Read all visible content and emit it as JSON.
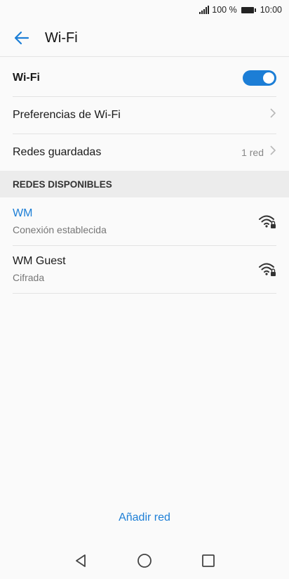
{
  "status_bar": {
    "battery_pct": "100 %",
    "time": "10:00"
  },
  "app_bar": {
    "title": "Wi-Fi"
  },
  "settings": {
    "wifi_label": "Wi-Fi",
    "wifi_enabled": true,
    "preferences_label": "Preferencias de Wi-Fi",
    "saved_label": "Redes guardadas",
    "saved_count": "1 red"
  },
  "available": {
    "header": "REDES DISPONIBLES",
    "networks": [
      {
        "name": "WM",
        "status": "Conexión establecida",
        "connected": true
      },
      {
        "name": "WM Guest",
        "status": "Cifrada",
        "connected": false
      }
    ]
  },
  "add_network_label": "Añadir red",
  "colors": {
    "accent": "#1c7ed6",
    "background": "#fafafa",
    "section_bg": "#ececec"
  }
}
